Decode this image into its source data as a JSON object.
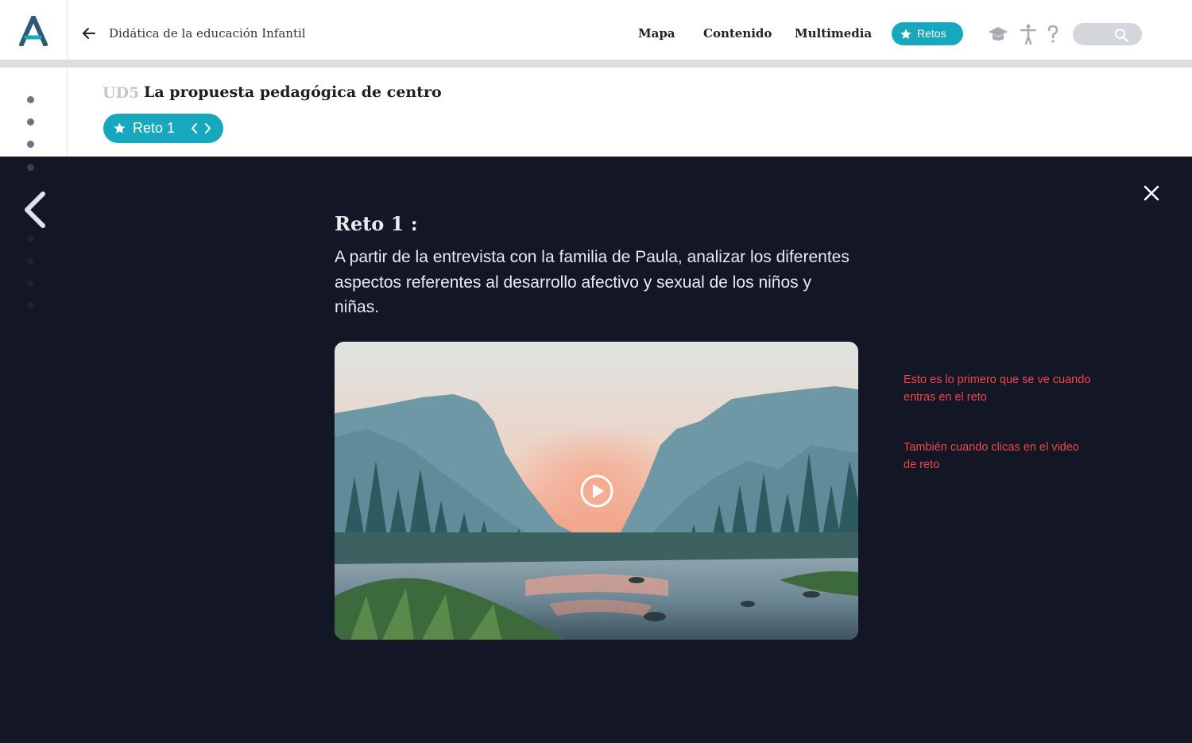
{
  "header": {
    "course_title": "Didática de la educación Infantil",
    "nav": [
      "Mapa",
      "Contenido",
      "Multimedia"
    ],
    "retos_label": "Retos",
    "icons": [
      "logo-a-icon",
      "back-arrow-icon",
      "star-icon",
      "graduation-cap-icon",
      "accessibility-icon",
      "help-icon",
      "search-icon"
    ]
  },
  "unit": {
    "code": "UD5",
    "title": "La propuesta pedagógica de centro"
  },
  "reto_selector": {
    "label": "Reto 1"
  },
  "modal": {
    "heading": "Reto 1 :",
    "description": "A partir de la entrevista con la familia de Paula, analizar los diferentes aspectos referentes al desarrollo afectivo y sexual de los niños y niñas."
  },
  "annotations": [
    "Esto es lo primero que se ve cuando entras en el reto",
    "También cuando clicas en el video de reto"
  ],
  "colors": {
    "accent": "#17a8bd",
    "overlay": "#131624",
    "annotation": "#f0474a",
    "logo": "#2d5a7b"
  }
}
